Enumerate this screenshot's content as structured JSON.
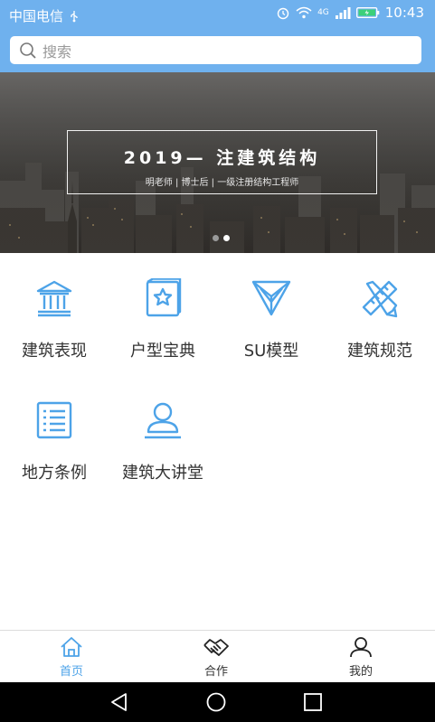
{
  "status_bar": {
    "carrier": "中国电信",
    "network_badge": "4G",
    "time": "10:43"
  },
  "search": {
    "placeholder": "搜索"
  },
  "banner": {
    "title": "2019— 注建筑结构",
    "subtitle": "明老师 | 博士后 | 一级注册结构工程师",
    "page_count": 2,
    "active_page": 2
  },
  "grid": {
    "items": [
      {
        "label": "建筑表现",
        "icon": "building-icon"
      },
      {
        "label": "户型宝典",
        "icon": "book-star-icon"
      },
      {
        "label": "SU模型",
        "icon": "su-model-icon"
      },
      {
        "label": "建筑规范",
        "icon": "ruler-pencil-icon"
      },
      {
        "label": "地方条例",
        "icon": "list-document-icon"
      },
      {
        "label": "建筑大讲堂",
        "icon": "lecturer-icon"
      }
    ]
  },
  "bottom_nav": {
    "items": [
      {
        "label": "首页",
        "icon": "home-icon",
        "active": true
      },
      {
        "label": "合作",
        "icon": "handshake-icon",
        "active": false
      },
      {
        "label": "我的",
        "icon": "user-icon",
        "active": false
      }
    ]
  },
  "colors": {
    "header": "#6fb1ee",
    "accent": "#4da3e8",
    "text": "#333333"
  }
}
